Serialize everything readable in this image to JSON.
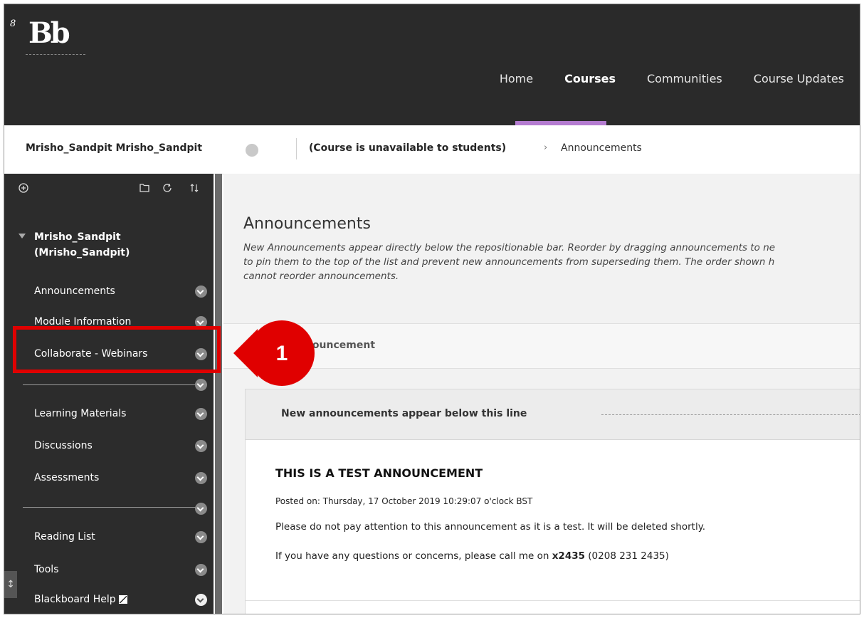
{
  "header": {
    "logo_text": "Bb",
    "logo_mark": "8",
    "nav": [
      {
        "label": "Home",
        "active": false
      },
      {
        "label": "Courses",
        "active": true
      },
      {
        "label": "Communities",
        "active": false
      },
      {
        "label": "Course Updates",
        "active": false
      }
    ],
    "active_color": "#b47cd0"
  },
  "breadcrumb": {
    "course": "Mrisho_Sandpit Mrisho_Sandpit",
    "status": "(Course is unavailable to students)",
    "separator": "›",
    "current": "Announcements"
  },
  "sidebar": {
    "tool_icons": [
      "add-icon",
      "folder-icon",
      "refresh-icon",
      "sort-icon"
    ],
    "course_title_line1": "Mrisho_Sandpit",
    "course_title_line2": "(Mrisho_Sandpit)",
    "items": [
      {
        "label": "Announcements"
      },
      {
        "label": "Module Information"
      },
      {
        "label": "Collaborate - Webinars"
      },
      {
        "label": "Learning Materials"
      },
      {
        "label": "Discussions"
      },
      {
        "label": "Assessments"
      },
      {
        "label": "Reading List"
      },
      {
        "label": "Tools"
      },
      {
        "label": "Blackboard Help"
      }
    ]
  },
  "main": {
    "title": "Announcements",
    "description": "New Announcements appear directly below the repositionable bar. Reorder by dragging announcements to ne\nto pin them to the top of the list and prevent new announcements from superseding them. The order shown h\ncannot reorder announcements.",
    "action_label": "nnouncement",
    "repositionable_label": "New announcements appear below this line",
    "announcement": {
      "title": "THIS IS A TEST ANNOUNCEMENT",
      "posted": "Posted on: Thursday, 17 October 2019 10:29:07 o'clock BST",
      "body1": "Please do not pay attention to this announcement as it is a test. It will be deleted shortly.",
      "body2_prefix": "If you have any questions or concerns, please call me on ",
      "body2_ext": "x2435",
      "body2_suffix": " (0208 231 2435)"
    }
  },
  "annotation": {
    "number": "1",
    "color": "#e00000"
  }
}
